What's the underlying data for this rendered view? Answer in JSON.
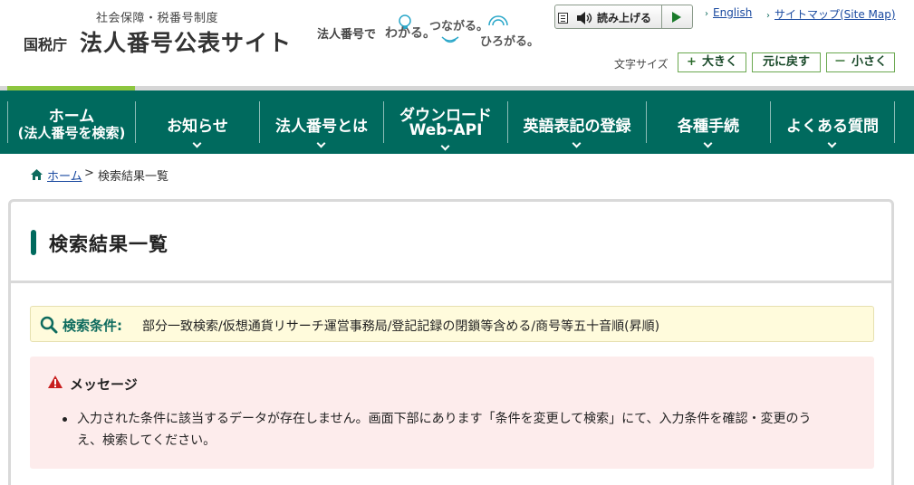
{
  "header": {
    "logo_sub": "社会保障・税番号制度",
    "logo_agency": "国税庁",
    "logo_main": "法人番号公表サイト",
    "tagline_prefix": "法人番号で",
    "tagline_word1": "わかる。",
    "tagline_word2": "つながる。",
    "tagline_word3": "ひろがる。",
    "read_aloud_label": "読み上げる",
    "link_english": "English",
    "link_sitemap": "サイトマップ(Site Map)",
    "font_size_label": "文字サイズ",
    "font_large_label": "大きく",
    "font_reset_label": "元に戻す",
    "font_small_label": "小さく",
    "font_large_sign": "+",
    "font_small_sign": "－"
  },
  "nav": {
    "items": [
      {
        "line1": "ホーム",
        "line2": "(法人番号を検索)"
      },
      {
        "line1": "お知らせ"
      },
      {
        "line1": "法人番号とは"
      },
      {
        "line1": "ダウンロード",
        "line2": "Web-API"
      },
      {
        "line1": "英語表記の登録"
      },
      {
        "line1": "各種手続"
      },
      {
        "line1": "よくある質問"
      }
    ]
  },
  "breadcrumb": {
    "home": "ホーム",
    "separator": ">",
    "current": "検索結果一覧"
  },
  "content": {
    "title": "検索結果一覧",
    "condition_label": "検索条件:",
    "condition_value": "部分一致検索/仮想通貨リサーチ運営事務局/登記記録の閉鎖等含める/商号等五十音順(昇順)",
    "message_title": "メッセージ",
    "message_line1": "入力された条件に該当するデータが存在しません。画面下部にあります「条件を変更して検索」にて、入力条件を確認・変更のう",
    "message_line2": "え、検索してください。"
  },
  "colors": {
    "brand_green": "#006a5e",
    "accent_lime": "#8dc63f",
    "condition_bg": "#fffbdc",
    "message_bg": "#fdecec",
    "warning_red": "#c81e1e",
    "link_blue": "#1a4aa0"
  }
}
